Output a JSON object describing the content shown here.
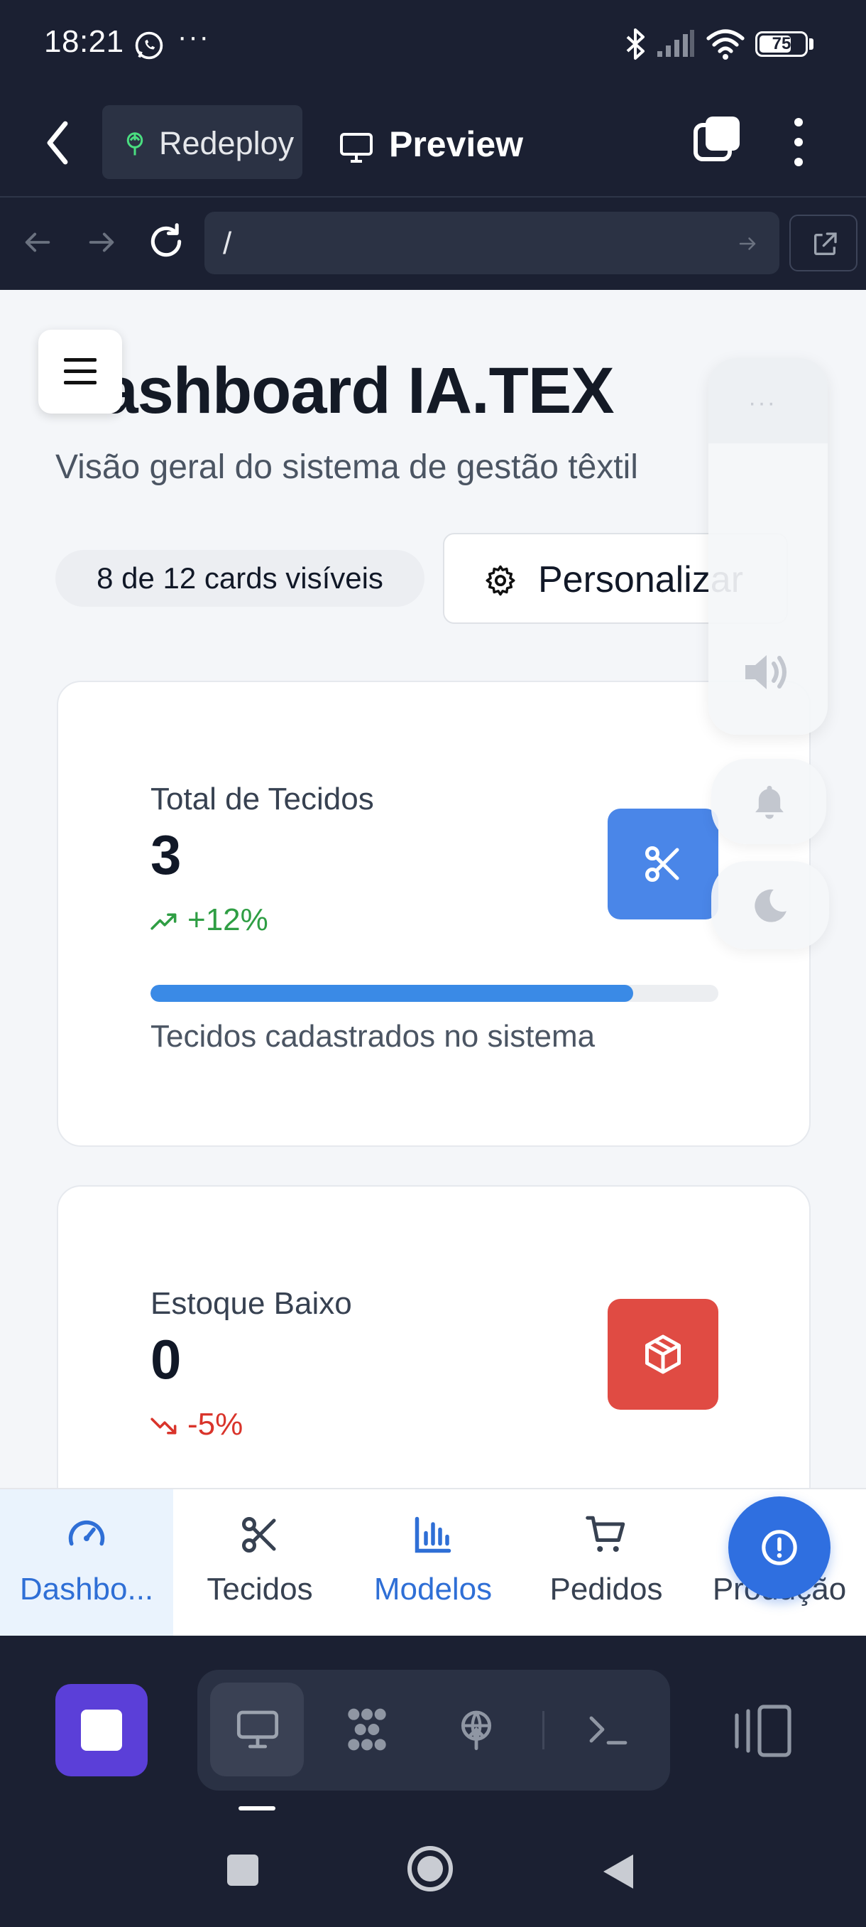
{
  "status_bar": {
    "time": "18:21",
    "dots": "···",
    "battery": "75",
    "icons": [
      "whatsapp-icon",
      "bluetooth-icon",
      "signal-icon",
      "wifi-icon",
      "battery-icon"
    ]
  },
  "app_bar": {
    "redeploy_label": "Redeploy",
    "preview_label": "Preview"
  },
  "browser": {
    "url": "/"
  },
  "page": {
    "title": "Dashboard IA.TEX",
    "subtitle": "Visão geral do sistema de gestão têxtil",
    "cards_count": "8 de 12 cards visíveis",
    "customize_label": "Personalizar"
  },
  "cards": [
    {
      "title": "Total de Tecidos",
      "value": "3",
      "trend": "+12%",
      "trend_direction": "up",
      "progress_percent": 85,
      "description": "Tecidos cadastrados no sistema",
      "icon": "scissors-icon",
      "color": "#4a86e8"
    },
    {
      "title": "Estoque Baixo",
      "value": "0",
      "trend": "-5%",
      "trend_direction": "down",
      "icon": "box-icon",
      "color": "#e04b43"
    }
  ],
  "floating_panel": {
    "dots": "···",
    "icons": [
      "volume-icon",
      "bell-icon",
      "moon-icon"
    ]
  },
  "bottom_nav": [
    {
      "label": "Dashbo...",
      "icon": "gauge-icon",
      "active": true
    },
    {
      "label": "Tecidos",
      "icon": "scissors-icon",
      "active": false
    },
    {
      "label": "Modelos",
      "icon": "bar-chart-icon",
      "active": false
    },
    {
      "label": "Pedidos",
      "icon": "cart-icon",
      "active": false
    },
    {
      "label": "Produção",
      "icon": "factory-icon",
      "active": false
    }
  ],
  "colors": {
    "dark_bg": "#1b2032",
    "primary_blue": "#2f6fe0",
    "stop_purple": "#5b3fd8",
    "trend_up": "#2f9e44",
    "trend_down": "#d9342b"
  }
}
